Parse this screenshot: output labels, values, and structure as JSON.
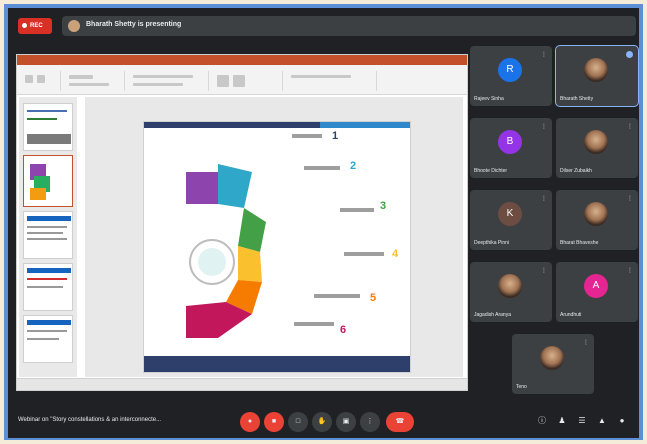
{
  "meeting": {
    "rec_label": "REC",
    "presenting_text": "Bharath Shetty is presenting",
    "title": "Webinar on \"Story constellations & an interconnecte..."
  },
  "participants": [
    {
      "name": "Rajeev Sinha",
      "initial": "R",
      "color": "#1a73e8"
    },
    {
      "name": "Bharath Shetty",
      "photo": true,
      "active": true
    },
    {
      "name": "Bhoote Dichter",
      "initial": "B",
      "color": "#9334e6"
    },
    {
      "name": "Dilser Zubaikh",
      "photo": true
    },
    {
      "name": "Deepthika Pinni",
      "initial": "K",
      "color": "#6d4c41"
    },
    {
      "name": "Bharat Bhaveshe",
      "photo": true
    },
    {
      "name": "Jagadish Aranya",
      "photo": true
    },
    {
      "name": "Arundhuti",
      "initial": "A",
      "color": "#e52592"
    },
    {
      "name": "Teno",
      "photo": true
    }
  ],
  "slide_numbers": [
    "1",
    "2",
    "3",
    "4",
    "5",
    "6"
  ],
  "icons": {
    "more": "more-vert-icon",
    "mic": "mic-icon"
  }
}
